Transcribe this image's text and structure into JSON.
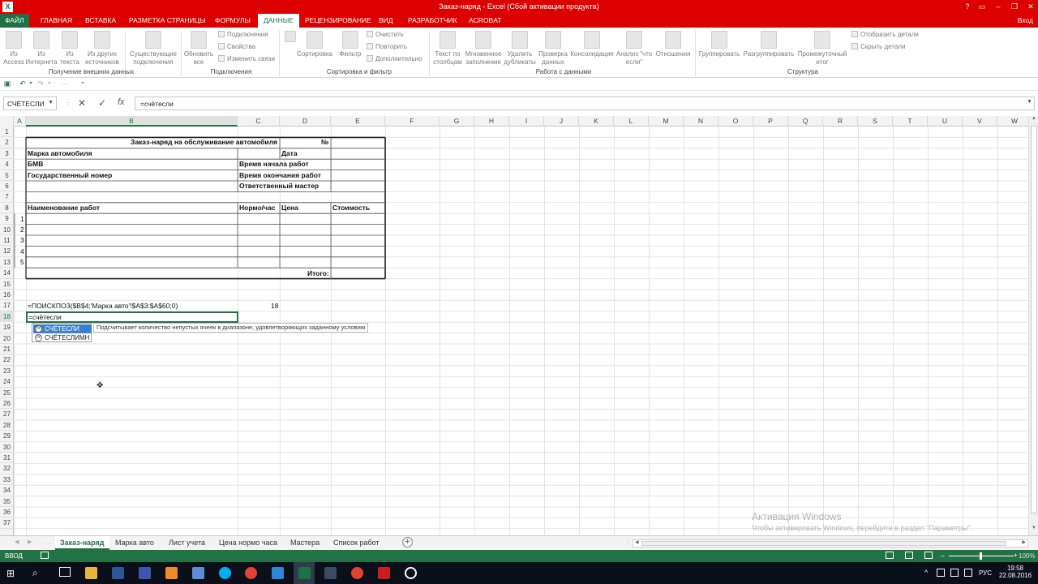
{
  "window": {
    "title": "Заказ-наряд - Excel (Сбой активации продукта)",
    "help": "?",
    "login": "Вход"
  },
  "ribbon_tabs": [
    "ФАЙЛ",
    "ГЛАВНАЯ",
    "ВСТАВКА",
    "РАЗМЕТКА СТРАНИЦЫ",
    "ФОРМУЛЫ",
    "ДАННЫЕ",
    "РЕЦЕНЗИРОВАНИЕ",
    "ВИД",
    "РАЗРАБОТЧИК",
    "ACROBAT"
  ],
  "ribbon": {
    "b1": [
      "Из",
      "Access"
    ],
    "b2": [
      "Из",
      "Интернета"
    ],
    "b3": [
      "Из",
      "текста"
    ],
    "b4": [
      "Из других",
      "источников"
    ],
    "b5": [
      "Существующие",
      "подключения"
    ],
    "b6": [
      "Обновить",
      "все"
    ],
    "s1": "Подключения",
    "s2": "Свойства",
    "s3": "Изменить связи",
    "b7": "Сортировка",
    "b8": "Фильтр",
    "s4": "Очистить",
    "s5": "Повторить",
    "s6": "Дополнительно",
    "b9": [
      "Текст по",
      "столбцам"
    ],
    "b10": [
      "Мгновенное",
      "заполнение"
    ],
    "b11": [
      "Удалить",
      "дубликаты"
    ],
    "b12": [
      "Проверка",
      "данных"
    ],
    "b13": "Консолидация",
    "b14": [
      "Анализ \"что",
      "если\""
    ],
    "b15": "Отношения",
    "b16": "Группировать",
    "b17": "Разгруппировать",
    "b18": [
      "Промежуточный",
      "итог"
    ],
    "s7": "Отобразить детали",
    "s8": "Скрыть детали",
    "groups": [
      "Получение внешних данных",
      "Подключения",
      "Сортировка и фильтр",
      "Работа с данными",
      "Структура"
    ]
  },
  "namebox": "СЧЁТЕСЛИ",
  "formula": "=счётесли",
  "columns": [
    "A",
    "B",
    "C",
    "D",
    "E",
    "F",
    "G",
    "H",
    "I",
    "J",
    "K",
    "L",
    "M",
    "N",
    "O",
    "P",
    "Q",
    "R",
    "S",
    "T",
    "U",
    "V",
    "W"
  ],
  "rows": [
    "1",
    "2",
    "3",
    "4",
    "5",
    "6",
    "7",
    "8",
    "9",
    "10",
    "11",
    "12",
    "13",
    "14",
    "15",
    "16",
    "17",
    "18",
    "19",
    "20",
    "21",
    "22",
    "23",
    "24",
    "25",
    "26",
    "27",
    "28",
    "29",
    "30",
    "31",
    "32",
    "33",
    "34",
    "35",
    "36",
    "37"
  ],
  "cells": {
    "title": "Заказ-наряд на обслуживание автомобиля",
    "num": "№",
    "car_brand": "Марка автомобиля",
    "date": "Дата",
    "bmw": "БМВ",
    "start": "Время начала работ",
    "plate": "Государственный номер",
    "end": "Время окончания работ",
    "master": "Ответственный мастер",
    "work_name": "Наименование работ",
    "norm": "Нормо/час",
    "price": "Цена",
    "cost": "Стоимость",
    "n1": "1",
    "n2": "2",
    "n3": "3",
    "n4": "4",
    "n5": "5",
    "total": "Итого:",
    "f17": "=ПОИСКПОЗ($B$4;'Марка авто'!$A$3:$A$60;0)",
    "v17": "18",
    "a18": "=счётесли"
  },
  "autocomplete": {
    "items": [
      "СЧЁТЕСЛИ",
      "СЧЁТЕСЛИМН"
    ],
    "fx": "fx",
    "tooltip": "Подсчитывает количество непустых ячеек в диапазоне, удовлетворяющих заданному условию"
  },
  "sheets": [
    "Заказ-наряд",
    "Марка авто",
    "Лист учета",
    "Цена нормо часа",
    "Мастера",
    "Список работ"
  ],
  "status": {
    "mode": "ВВОД",
    "zoom": "100%"
  },
  "watermark": {
    "title": "Активация Windows",
    "text": "Чтобы активировать Windows, перейдите в раздел \"Параметры\"."
  },
  "taskbar": {
    "time": "19:58",
    "date": "22.08.2016",
    "lang": "РУС"
  },
  "colors": {
    "excel_green": "#217346",
    "title_red": "#dc0000",
    "selection_blue": "#3c7fce"
  }
}
